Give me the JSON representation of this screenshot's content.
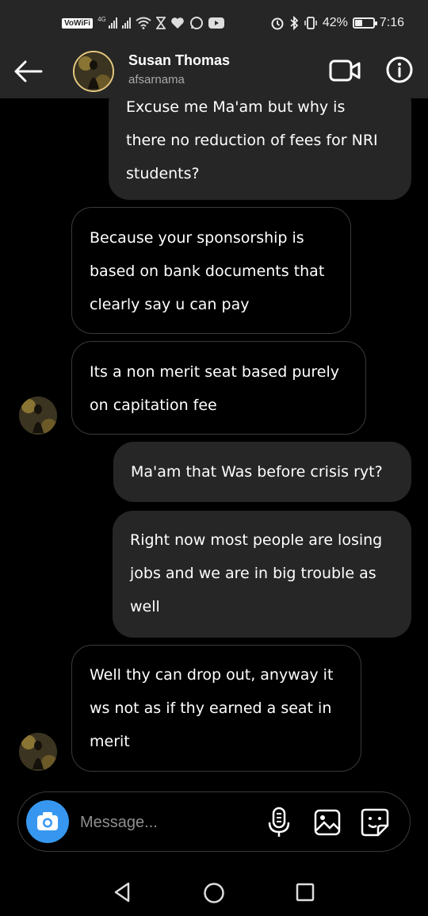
{
  "status_bar": {
    "volte": "VoWiFi",
    "network_tag": "4G",
    "battery_text": "42%",
    "battery_level": 0.42,
    "time": "7:16",
    "icons": [
      "signal-icon",
      "wifi-icon",
      "hourglass-icon",
      "heart-icon",
      "whatsapp-icon",
      "youtube-icon",
      "alarm-icon",
      "bluetooth-icon",
      "vibrate-icon",
      "battery-icon"
    ]
  },
  "header": {
    "name": "Susan Thomas",
    "username": "afsarnama",
    "icons": [
      "back-arrow-icon",
      "video-call-icon",
      "info-icon"
    ]
  },
  "messages": [
    {
      "direction": "outgoing",
      "lines": [
        "Excuse me Ma'am but why is",
        "there no reduction of fees for NRI",
        "students?"
      ]
    },
    {
      "direction": "incoming",
      "lines": [
        "Because your sponsorship is",
        "based on bank documents that",
        "clearly say u can pay"
      ]
    },
    {
      "direction": "incoming",
      "lines": [
        "Its a non merit seat based purely",
        "on capitation fee"
      ]
    },
    {
      "direction": "outgoing",
      "lines": [
        "Ma'am that Was before crisis ryt?"
      ]
    },
    {
      "direction": "outgoing",
      "lines": [
        "Right now most people are losing",
        "jobs and we are in big trouble as",
        "well"
      ]
    },
    {
      "direction": "incoming",
      "lines": [
        "Well thy can drop out, anyway it",
        "ws not as if thy earned a seat in",
        "merit"
      ]
    }
  ],
  "composer": {
    "placeholder": "Message...",
    "icons": [
      "camera-icon",
      "microphone-icon",
      "gallery-icon",
      "sticker-icon"
    ],
    "accent": "#3797f0"
  },
  "nav": {
    "icons": [
      "nav-back-icon",
      "nav-home-icon",
      "nav-recents-icon"
    ]
  },
  "colors": {
    "bar_bg": "#262626",
    "outgoing_bubble": "#262626",
    "incoming_border": "#3a3a3a",
    "avatar_ring": "#e6c980"
  }
}
